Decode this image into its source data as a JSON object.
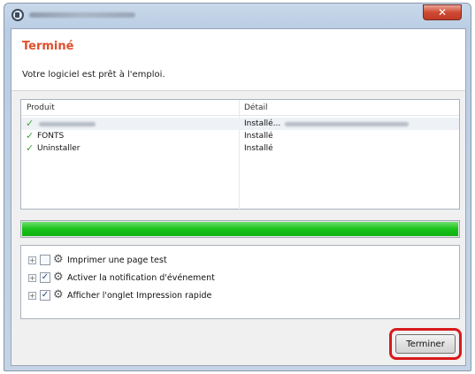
{
  "window": {
    "close_glyph": "✕"
  },
  "header": {
    "title": "Terminé",
    "subtitle": "Votre logiciel est prêt à l'emploi."
  },
  "table": {
    "columns": [
      "Produit",
      "Détail"
    ],
    "rows": [
      {
        "status_icon": "check-icon",
        "product": "",
        "detail": "Installé..."
      },
      {
        "status_icon": "check-icon",
        "product": "FONTS",
        "detail": "Installé"
      },
      {
        "status_icon": "check-icon",
        "product": "Uninstaller",
        "detail": "Installé"
      }
    ]
  },
  "progress": {
    "fraction": 1.0,
    "color": "#19c219"
  },
  "options": [
    {
      "label": "Imprimer une page test",
      "checked": false
    },
    {
      "label": "Activer la notification d'événement",
      "checked": true
    },
    {
      "label": "Afficher l'onglet Impression rapide",
      "checked": true
    }
  ],
  "footer": {
    "finish_label": "Terminer",
    "highlight_color": "#d9191b"
  },
  "colors": {
    "title_accent": "#e04f2b",
    "check_green": "#3aa63a"
  }
}
